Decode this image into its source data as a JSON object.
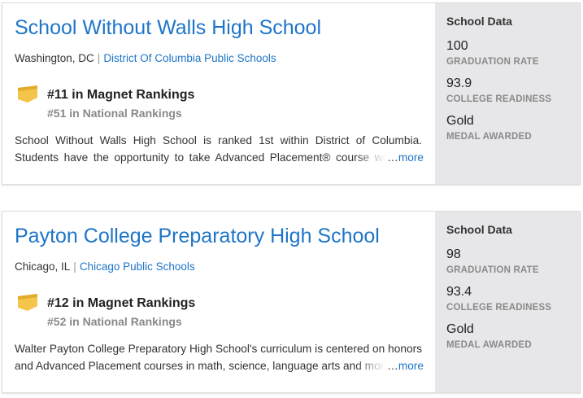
{
  "results": [
    {
      "title": "School Without Walls High School",
      "location": "Washington, DC",
      "separator": "|",
      "district": "District Of Columbia Public Schools",
      "rank_primary": "#11 in Magnet Rankings",
      "rank_secondary": "#51 in National Rankings",
      "description": "School Without Walls High School is ranked 1st within District of Columbia. Students have the opportunity to take Advanced Placement® course work and exams.",
      "ellipsis": "…",
      "more_label": "more",
      "school_data": {
        "heading": "School Data",
        "graduation_rate": "100",
        "graduation_rate_label": "GRADUATION RATE",
        "college_readiness": "93.9",
        "college_readiness_label": "COLLEGE READINESS",
        "medal": "Gold",
        "medal_label": "MEDAL AWARDED"
      }
    },
    {
      "title": "Payton College Preparatory High School",
      "location": "Chicago, IL",
      "separator": "|",
      "district": "Chicago Public Schools",
      "rank_primary": "#12 in Magnet Rankings",
      "rank_secondary": "#52 in National Rankings",
      "description": "Walter Payton College Preparatory High School's curriculum is centered on honors and Advanced Placement courses in math, science, language arts and more.",
      "ellipsis": "…",
      "more_label": "more",
      "school_data": {
        "heading": "School Data",
        "graduation_rate": "98",
        "graduation_rate_label": "GRADUATION RATE",
        "college_readiness": "93.4",
        "college_readiness_label": "COLLEGE READINESS",
        "medal": "Gold",
        "medal_label": "MEDAL AWARDED"
      }
    }
  ],
  "colors": {
    "link": "#1e75c8",
    "medal_gold": "#f5c44a",
    "sidebar_bg": "#e7e7ea"
  },
  "icons": {
    "medal": "gold-medal-icon"
  }
}
